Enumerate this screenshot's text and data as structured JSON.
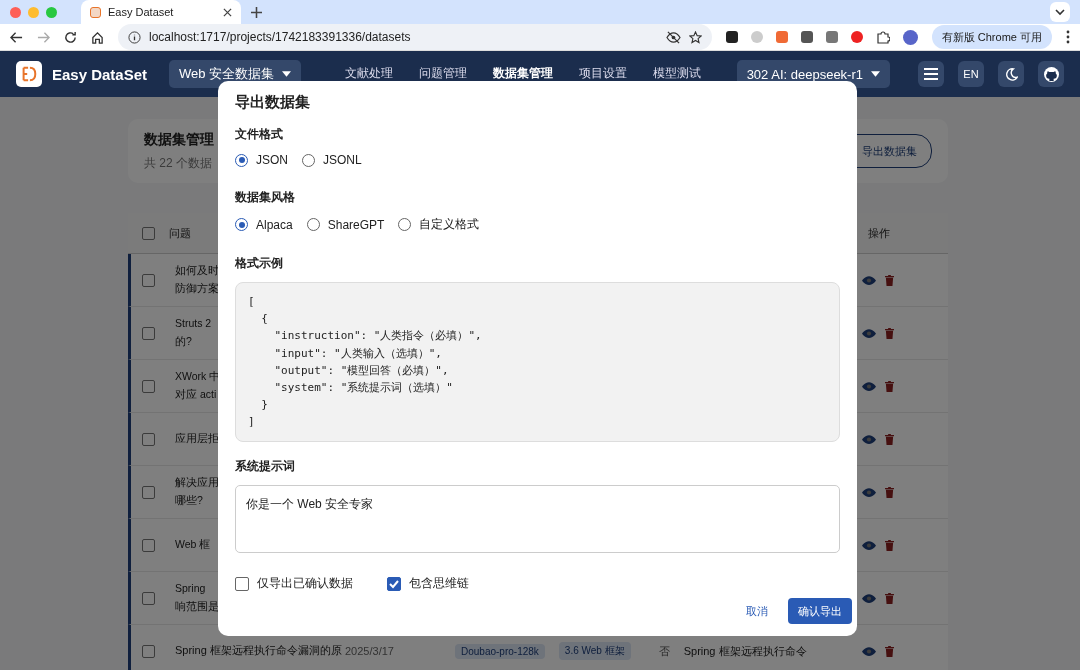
{
  "browser": {
    "tab_title": "Easy Dataset",
    "url": "localhost:1717/projects/1742183391336/datasets",
    "update_label": "有新版 Chrome 可用"
  },
  "app_bar": {
    "brand": "Easy DataSet",
    "project": "Web 安全数据集",
    "nav": [
      {
        "label": "文献处理",
        "selected": false
      },
      {
        "label": "问题管理",
        "selected": false
      },
      {
        "label": "数据集管理",
        "selected": true
      },
      {
        "label": "项目设置",
        "selected": false
      },
      {
        "label": "模型测试",
        "selected": false
      }
    ],
    "model": "302 AI: deepseek-r1",
    "language": "EN"
  },
  "page": {
    "title": "数据集管理",
    "subtitle": "共 22 个数据",
    "export_button": "导出数据集"
  },
  "table": {
    "columns": [
      "问题",
      "操作"
    ],
    "header_checked": false,
    "rows": [
      {
        "checked": false,
        "question": [
          "如何及时",
          "防御方案"
        ]
      },
      {
        "checked": false,
        "question": [
          "Struts 2",
          "的?"
        ]
      },
      {
        "checked": false,
        "question": [
          "XWork 中",
          "对应 acti"
        ]
      },
      {
        "checked": false,
        "question": [
          "应用层拒"
        ]
      },
      {
        "checked": false,
        "question": [
          "解决应用",
          "哪些?"
        ]
      },
      {
        "checked": false,
        "question": [
          "Web 框"
        ]
      },
      {
        "checked": false,
        "question": [
          "Spring",
          "响范围是"
        ]
      }
    ],
    "last_row": {
      "checked": false,
      "question": "Spring 框架远程执行命令漏洞的原",
      "date": "2025/3/17",
      "model": "Doubao-pro-128k",
      "tag": "3.6 Web 框架",
      "confirmed": "否",
      "answer": "Spring 框架远程执行命令"
    }
  },
  "dialog": {
    "title": "导出数据集",
    "file_format": {
      "label": "文件格式",
      "options": [
        {
          "label": "JSON",
          "selected": true
        },
        {
          "label": "JSONL",
          "selected": false
        }
      ]
    },
    "style": {
      "label": "数据集风格",
      "options": [
        {
          "label": "Alpaca",
          "selected": true
        },
        {
          "label": "ShareGPT",
          "selected": false
        },
        {
          "label": "自定义格式",
          "selected": false
        }
      ]
    },
    "example": {
      "label": "格式示例",
      "lines": [
        "[",
        "  {",
        "    \"instruction\": \"人类指令（必填）\",",
        "    \"input\": \"人类输入（选填）\",",
        "    \"output\": \"模型回答（必填）\",",
        "    \"system\": \"系统提示词（选填）\"",
        "  }",
        "]"
      ]
    },
    "system_prompt": {
      "label": "系统提示词",
      "value": "你是一个 Web 安全专家"
    },
    "options": [
      {
        "label": "仅导出已确认数据",
        "checked": false
      },
      {
        "label": "包含思维链",
        "checked": true
      }
    ],
    "cancel": "取消",
    "confirm": "确认导出"
  }
}
